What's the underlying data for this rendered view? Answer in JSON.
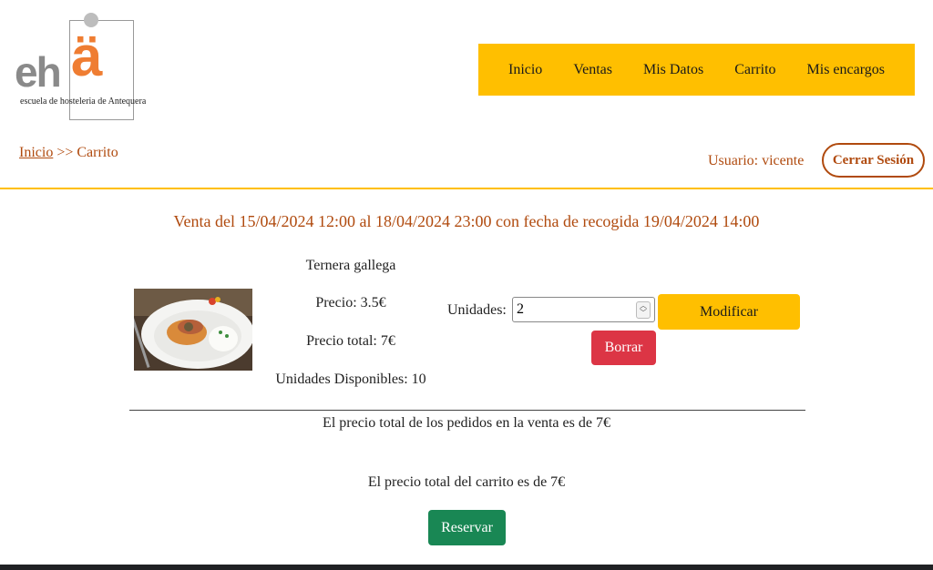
{
  "logo": {
    "letters_e": "eh",
    "letters_a": "ä",
    "subtitle": "escuela de hosteleria de Antequera"
  },
  "nav": {
    "items": [
      "Inicio",
      "Ventas",
      "Mis Datos",
      "Carrito",
      "Mis encargos"
    ]
  },
  "breadcrumb": {
    "home": "Inicio",
    "separator": " >> ",
    "current": "Carrito"
  },
  "user": {
    "label": "Usuario: vicente",
    "logout": "Cerrar Sesión"
  },
  "sale": {
    "title": "Venta del 15/04/2024 12:00 al 18/04/2024 23:00 con fecha de recogida 19/04/2024 14:00"
  },
  "product": {
    "name": "Ternera gallega",
    "price": "Precio: 3.5€",
    "total": "Precio total: 7€",
    "available": "Unidades Disponibles: 10",
    "units_label": "Unidades:",
    "units_value": "2",
    "modify": "Modificar",
    "delete": "Borrar"
  },
  "totals": {
    "sale_total": "El precio total de los pedidos en la venta es de 7€",
    "cart_total": "El precio total del carrito es de 7€",
    "reserve": "Reservar"
  },
  "colors": {
    "accent": "#ffbf00",
    "brand_text": "#b04a0e",
    "danger": "#dc3545",
    "success": "#198754",
    "logo_orange": "#ef7d32"
  }
}
